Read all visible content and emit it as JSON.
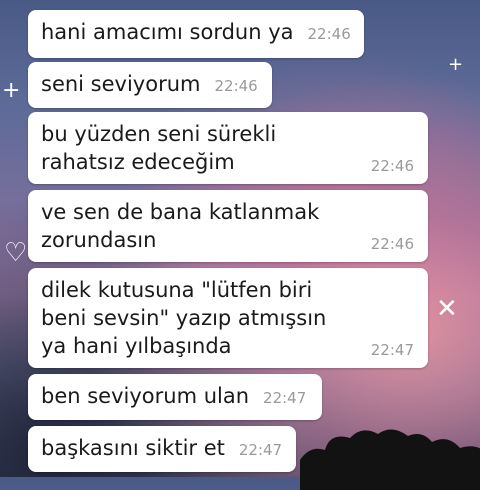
{
  "messages": [
    {
      "text": "hani amacımı sordun ya",
      "time": "22:46"
    },
    {
      "text": "seni seviyorum",
      "time": "22:46"
    },
    {
      "text": "bu yüzden seni sürekli\nrahatsız edeceğim",
      "time": "22:46"
    },
    {
      "text": "ve sen de bana katlanmak\nzorundasın",
      "time": "22:46"
    },
    {
      "text": "dilek kutusuna \"lütfen biri\nbeni sevsin\" yazıp atmışsın\nya hani yılbaşında",
      "time": "22:47"
    },
    {
      "text": "ben seviyorum ulan",
      "time": "22:47"
    },
    {
      "text": "başkasını siktir et",
      "time": "22:47"
    }
  ]
}
